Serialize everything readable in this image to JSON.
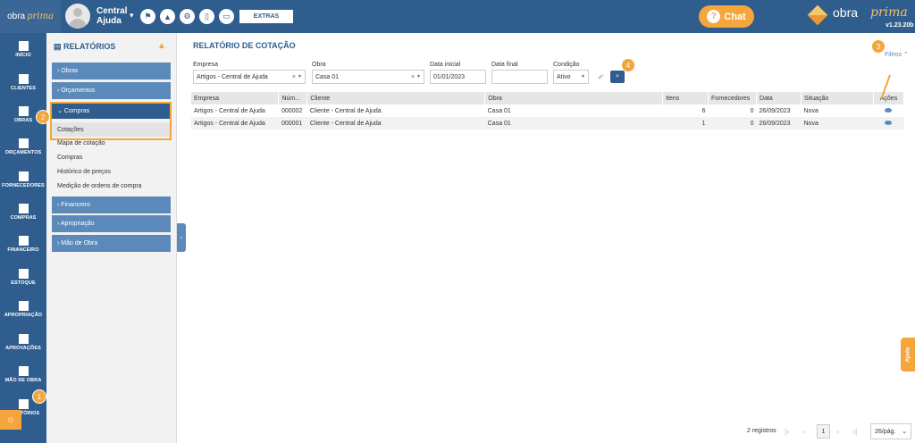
{
  "header": {
    "logo_a": "obra",
    "logo_b": "prima",
    "user_name": "Central Ajuda",
    "extras_label": "EXTRAS",
    "chat_label": "Chat",
    "brand_a": "obra",
    "brand_b": "prima",
    "version": "v1.23.20b"
  },
  "leftnav": [
    {
      "label": "INÍCIO",
      "icon": "home-icon"
    },
    {
      "label": "CLIENTES",
      "icon": "user-icon"
    },
    {
      "label": "OBRAS",
      "icon": "building-icon"
    },
    {
      "label": "ORÇAMENTOS",
      "icon": "document-icon"
    },
    {
      "label": "FORNECEDORES",
      "icon": "truck-icon"
    },
    {
      "label": "COMPRAS",
      "icon": "cart-icon"
    },
    {
      "label": "FINANCEIRO",
      "icon": "calculator-icon"
    },
    {
      "label": "ESTOQUE",
      "icon": "boxes-icon"
    },
    {
      "label": "APROPRIAÇÃO",
      "icon": "file-icon"
    },
    {
      "label": "APROVAÇÕES",
      "icon": "check-list-icon"
    },
    {
      "label": "MÃO DE OBRA",
      "icon": "workers-icon"
    },
    {
      "label": "RELATÓRIOS",
      "icon": "report-icon"
    }
  ],
  "submenu": {
    "title": "RELATÓRIOS",
    "sections": {
      "obras": "› Obras",
      "orcamentos": "› Orçamentos",
      "compras": "⌄ Compras",
      "financeiro": "› Financeiro",
      "apropriacao": "› Apropriação",
      "mao_de_obra": "› Mão de Obra"
    },
    "compras_links": [
      "Cotações",
      "Mapa de cotação",
      "Compras",
      "Histórico de preços",
      "Medição de ordens de compra"
    ]
  },
  "main": {
    "title": "RELATÓRIO DE COTAÇÃO",
    "filtros_label": "Filtros",
    "filters": {
      "empresa_label": "Empresa",
      "empresa_value": "Artigos - Central de Ajuda",
      "obra_label": "Obra",
      "obra_value": "Casa 01",
      "data_inicial_label": "Data inicial",
      "data_inicial_value": "01/01/2023",
      "data_final_label": "Data final",
      "data_final_value": "",
      "condicao_label": "Condição",
      "condicao_value": "Ativo"
    },
    "table": {
      "headers": [
        "Empresa",
        "Núm...",
        "Cliente",
        "Obra",
        "Itens",
        "Fornecedores",
        "Data",
        "Situação",
        "Ações"
      ],
      "rows": [
        [
          "Artigos - Central de Ajuda",
          "000002",
          "Cliente - Central de Ajuda",
          "Casa 01",
          "6",
          "0",
          "26/09/2023",
          "Nova"
        ],
        [
          "Artigos - Central de Ajuda",
          "000001",
          "Cliente - Central de Ajuda",
          "Casa 01",
          "1",
          "0",
          "26/09/2023",
          "Nova"
        ]
      ]
    },
    "pagination": {
      "count": "2 registros",
      "current": "1",
      "page_size": "26/pág."
    },
    "ajuda_label": "Ajuda"
  },
  "steps": [
    "1",
    "2",
    "3",
    "4"
  ],
  "colors": {
    "primary": "#2f5d8e",
    "accent": "#f4a63c",
    "menu": "#5b89b9"
  }
}
